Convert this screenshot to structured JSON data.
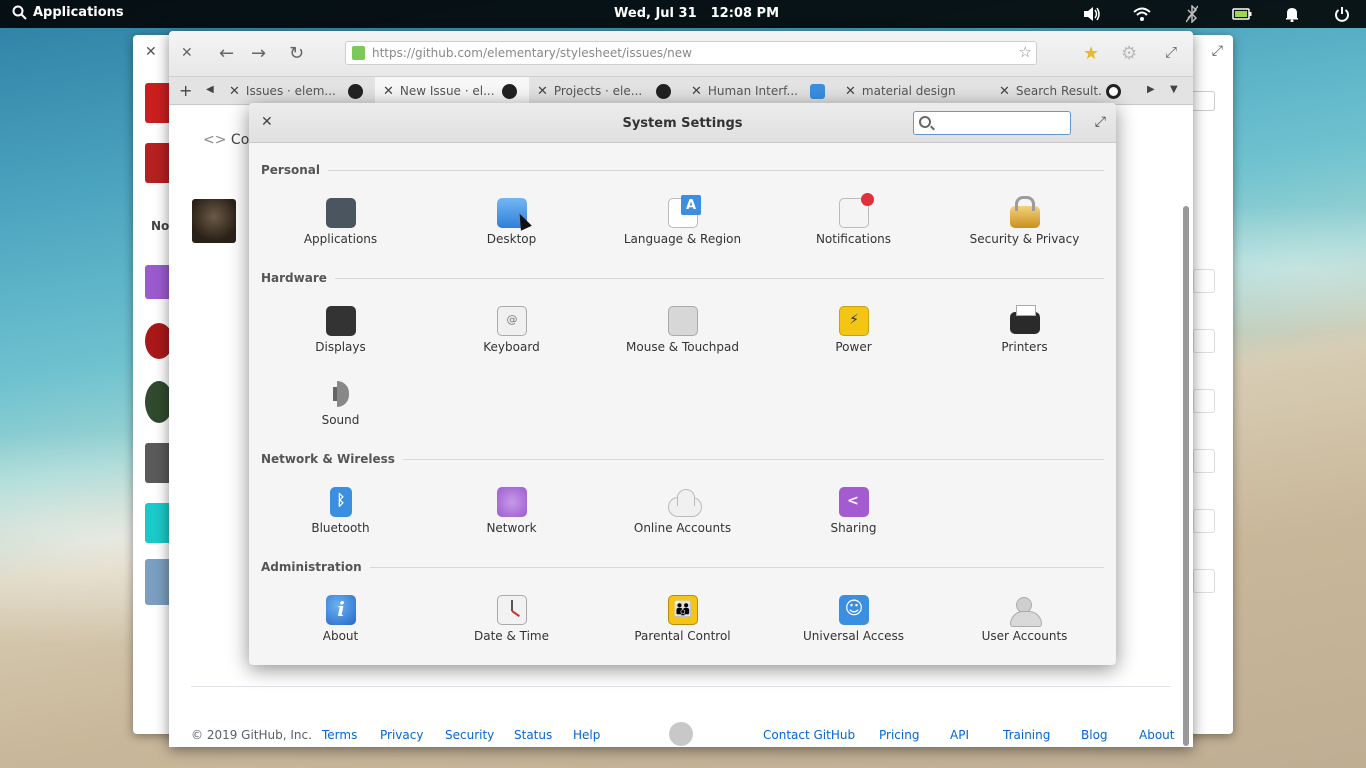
{
  "top_panel": {
    "applications_label": "Applications",
    "date": "Wed, Jul 31",
    "time": "12:08 PM",
    "indicators": [
      "sound-icon",
      "wifi-icon",
      "bluetooth-icon",
      "battery-icon",
      "notifications-icon",
      "power-icon"
    ]
  },
  "browser": {
    "url": "https://github.com/elementary/stylesheet/issues/new",
    "tabs": [
      {
        "label": "Issues · elem..."
      },
      {
        "label": "New Issue · el..."
      },
      {
        "label": "Projects · ele..."
      },
      {
        "label": "Human Interf..."
      },
      {
        "label": "material design ..."
      },
      {
        "label": "Search Result..."
      }
    ]
  },
  "github_page": {
    "code_tab": "Cod",
    "sidebar_label": "No",
    "footer": {
      "copyright": "© 2019 GitHub, Inc.",
      "links_left": [
        "Terms",
        "Privacy",
        "Security",
        "Status",
        "Help"
      ],
      "links_right": [
        "Contact GitHub",
        "Pricing",
        "API",
        "Training",
        "Blog",
        "About"
      ]
    }
  },
  "settings": {
    "title": "System Settings",
    "search_value": "",
    "sections": [
      {
        "name": "Personal",
        "items": [
          {
            "label": "Applications",
            "icon": "applications-icon"
          },
          {
            "label": "Desktop",
            "icon": "desktop-icon"
          },
          {
            "label": "Language & Region",
            "icon": "language-icon"
          },
          {
            "label": "Notifications",
            "icon": "notifications-icon"
          },
          {
            "label": "Security & Privacy",
            "icon": "lock-icon"
          }
        ]
      },
      {
        "name": "Hardware",
        "items": [
          {
            "label": "Displays",
            "icon": "display-icon"
          },
          {
            "label": "Keyboard",
            "icon": "keyboard-icon"
          },
          {
            "label": "Mouse & Touchpad",
            "icon": "mouse-icon"
          },
          {
            "label": "Power",
            "icon": "power-icon"
          },
          {
            "label": "Printers",
            "icon": "printer-icon"
          },
          {
            "label": "Sound",
            "icon": "speaker-icon"
          }
        ]
      },
      {
        "name": "Network & Wireless",
        "items": [
          {
            "label": "Bluetooth",
            "icon": "bluetooth-icon"
          },
          {
            "label": "Network",
            "icon": "network-icon"
          },
          {
            "label": "Online Accounts",
            "icon": "cloud-icon"
          },
          {
            "label": "Sharing",
            "icon": "share-icon"
          }
        ]
      },
      {
        "name": "Administration",
        "items": [
          {
            "label": "About",
            "icon": "info-icon"
          },
          {
            "label": "Date & Time",
            "icon": "clock-icon"
          },
          {
            "label": "Parental Control",
            "icon": "family-icon"
          },
          {
            "label": "Universal Access",
            "icon": "accessibility-icon"
          },
          {
            "label": "User Accounts",
            "icon": "users-icon"
          }
        ]
      }
    ]
  }
}
